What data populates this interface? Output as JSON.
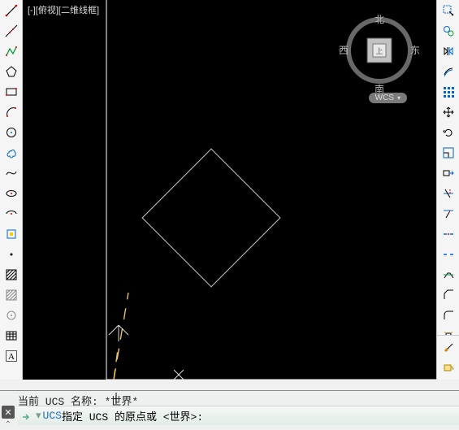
{
  "viewport": {
    "label": "[-][俯视][二维线框]"
  },
  "compass": {
    "north": "北",
    "south": "南",
    "east": "东",
    "west": "西"
  },
  "wcs": {
    "label": "WCS"
  },
  "command": {
    "history_line": "当前 UCS 名称: *世界*",
    "keyword": "UCS",
    "prompt_rest": " 指定 UCS 的原点或  <世界>:",
    "input_value": ""
  },
  "left_tools": [
    "line-icon",
    "construction-line-icon",
    "polyline-icon",
    "polygon-icon",
    "rectangle-icon",
    "arc-3pt-icon",
    "circle-icon",
    "revision-cloud-icon",
    "spline-icon",
    "ellipse-icon",
    "ellipse-arc-icon",
    "insert-block-icon",
    "point-icon",
    "hatch-icon",
    "gradient-icon",
    "region-icon",
    "table-icon",
    "text-icon"
  ],
  "right_tools_a": [
    "select-icon",
    "select-similar-icon",
    "mirror-icon",
    "offset-icon",
    "array-icon",
    "move-icon",
    "rotate-icon",
    "scale-icon",
    "stretch-icon",
    "trim-icon",
    "extend-icon",
    "break-at-point-icon",
    "break-icon",
    "join-icon",
    "chamfer-icon",
    "fillet-icon",
    "explode-icon"
  ],
  "right_tools_b": [
    "brush-icon",
    "bucket-icon"
  ]
}
